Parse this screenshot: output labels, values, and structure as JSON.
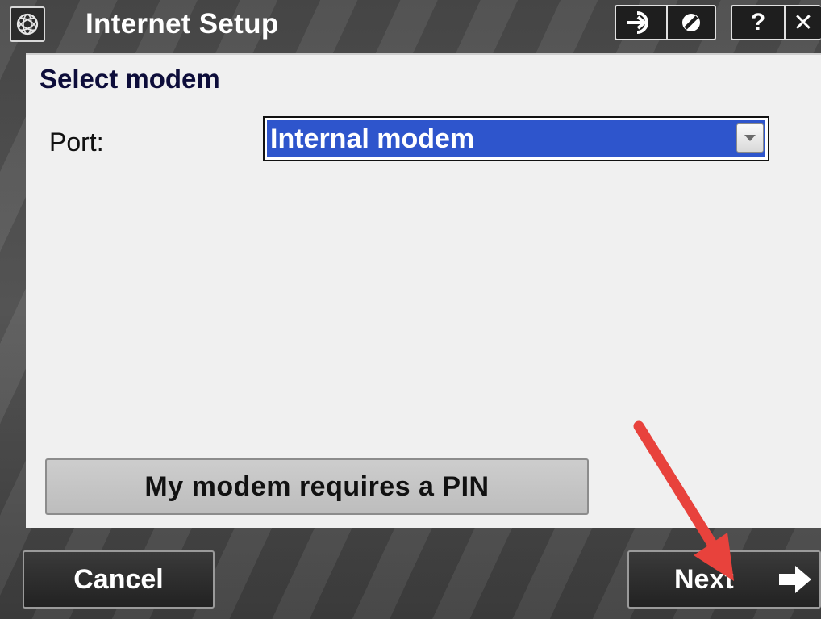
{
  "window": {
    "title": "Internet Setup"
  },
  "titlebar_icons": {
    "app": "trimble-globe-icon",
    "buttons": [
      "switch-to-icon",
      "disconnect-icon",
      "help-icon",
      "close-icon"
    ],
    "help_glyph": "?",
    "close_glyph": "✕"
  },
  "main": {
    "section_title": "Select modem",
    "port_label": "Port:",
    "port_value": "Internal modem",
    "pin_button_label": "My modem requires a PIN"
  },
  "footer": {
    "cancel_label": "Cancel",
    "next_label": "Next"
  },
  "colors": {
    "selection": "#2e55cc",
    "annotation_arrow": "#e8423c"
  }
}
